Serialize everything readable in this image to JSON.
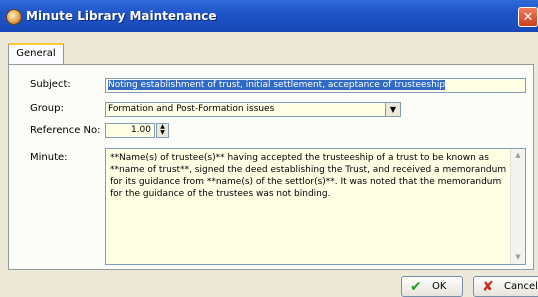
{
  "window": {
    "title": "Minute Library Maintenance",
    "close": "✕"
  },
  "tabs": [
    {
      "label": "General"
    }
  ],
  "form": {
    "subject_label": "Subject:",
    "subject_value": "Noting establishment of trust, initial settlement, acceptance of trusteeship",
    "group_label": "Group:",
    "group_value": "Formation and Post-Formation issues",
    "refno_label": "Reference No:",
    "refno_value": "1.00",
    "minute_label": "Minute:",
    "minute_value": "**Name(s) of trustee(s)** having accepted the trusteeship of a trust to be known as **name of trust**, signed the deed establishing the Trust, and received a memorandum for its guidance from **name(s) of the settlor(s)**. It was noted that the memorandum for the guidance of the trustees was not binding."
  },
  "buttons": {
    "ok": "OK",
    "cancel": "Cancel"
  },
  "icons": {
    "app": "app-icon",
    "close": "close-icon",
    "dropdown": "chevron-down-icon",
    "spin_up": "spin-up-icon",
    "spin_down": "spin-down-icon",
    "ok": "check-icon",
    "cancel": "x-icon"
  }
}
